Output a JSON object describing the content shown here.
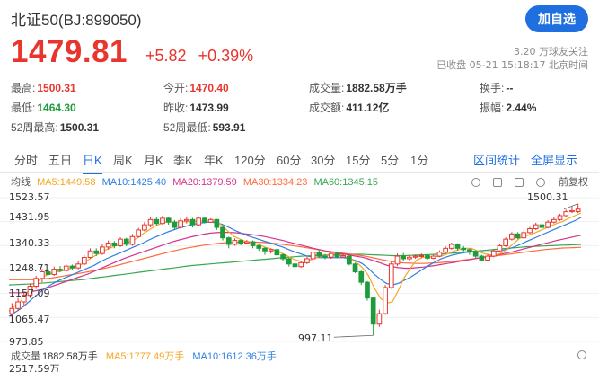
{
  "header": {
    "title": "北证50(BJ:899050)",
    "add_button": "加自选"
  },
  "quote": {
    "price": "1479.81",
    "change": "+5.82",
    "change_pct": "+0.39%",
    "followers": "3.20 万球友关注",
    "status": "已收盘 05-21 15:18:17 北京时间"
  },
  "stats": {
    "high_label": "最高:",
    "high": "1500.31",
    "low_label": "最低:",
    "low": "1464.30",
    "open_label": "今开:",
    "open": "1470.40",
    "prev_label": "昨收:",
    "prev": "1473.99",
    "vol_label": "成交量:",
    "vol": "1882.58万手",
    "amt_label": "成交额:",
    "amt": "411.12亿",
    "turnover_label": "换手:",
    "turnover": "--",
    "amplitude_label": "振幅:",
    "amplitude": "2.44%",
    "w52h_label": "52周最高:",
    "w52h": "1500.31",
    "w52l_label": "52周最低:",
    "w52l": "593.91"
  },
  "tabs": [
    "分时",
    "五日",
    "日K",
    "周K",
    "月K",
    "季K",
    "年K",
    "120分",
    "60分",
    "30分",
    "15分",
    "5分",
    "1分"
  ],
  "tab_right": [
    "区间统计",
    "全屏显示"
  ],
  "ma_legend": {
    "prefix": "均线",
    "ma5": "MA5:1449.58",
    "ma10": "MA10:1425.40",
    "ma20": "MA20:1379.59",
    "ma30": "MA30:1334.23",
    "ma60": "MA60:1345.15"
  },
  "tools": {
    "restore": "前复权"
  },
  "axis": {
    "y1": "1523.57",
    "y2": "1431.95",
    "y3": "1340.33",
    "y4": "1248.71",
    "y5": "1157.09",
    "y6": "1065.47",
    "y7": "973.85",
    "high_mark": "1500.31",
    "low_mark": "997.11"
  },
  "volume": {
    "label": "成交量",
    "value": "1882.58万手",
    "ma5": "MA5:1777.49万手",
    "ma10": "MA10:1612.36万手",
    "max": "2517.59万"
  },
  "colors": {
    "up": "#e8352e",
    "down": "#1e9b3a",
    "ma5": "#f5a623",
    "ma10": "#2f7fe0",
    "ma20": "#d6338a",
    "ma30": "#ff6b3d",
    "ma60": "#3aa655",
    "accent": "#1f6fe0"
  },
  "chart_data": {
    "type": "candlestick",
    "y_range": [
      973.85,
      1523.57
    ],
    "candles": [
      [
        1080,
        1100,
        1050,
        1120
      ],
      [
        1100,
        1125,
        1090,
        1140
      ],
      [
        1125,
        1150,
        1110,
        1160
      ],
      [
        1150,
        1185,
        1140,
        1195
      ],
      [
        1185,
        1215,
        1175,
        1225
      ],
      [
        1215,
        1240,
        1200,
        1250
      ],
      [
        1240,
        1230,
        1220,
        1255
      ],
      [
        1230,
        1250,
        1225,
        1260
      ],
      [
        1250,
        1245,
        1238,
        1262
      ],
      [
        1245,
        1262,
        1240,
        1270
      ],
      [
        1262,
        1255,
        1248,
        1268
      ],
      [
        1255,
        1270,
        1250,
        1280
      ],
      [
        1270,
        1295,
        1265,
        1305
      ],
      [
        1295,
        1320,
        1290,
        1330
      ],
      [
        1320,
        1310,
        1300,
        1330
      ],
      [
        1310,
        1335,
        1305,
        1345
      ],
      [
        1335,
        1350,
        1325,
        1360
      ],
      [
        1350,
        1340,
        1330,
        1358
      ],
      [
        1340,
        1365,
        1335,
        1372
      ],
      [
        1365,
        1345,
        1338,
        1370
      ],
      [
        1345,
        1375,
        1340,
        1385
      ],
      [
        1375,
        1400,
        1370,
        1408
      ],
      [
        1400,
        1420,
        1395,
        1430
      ],
      [
        1420,
        1440,
        1410,
        1450
      ],
      [
        1440,
        1425,
        1415,
        1448
      ],
      [
        1425,
        1445,
        1420,
        1455
      ],
      [
        1445,
        1430,
        1420,
        1450
      ],
      [
        1430,
        1410,
        1400,
        1438
      ],
      [
        1410,
        1435,
        1405,
        1445
      ],
      [
        1435,
        1440,
        1425,
        1452
      ],
      [
        1440,
        1420,
        1410,
        1446
      ],
      [
        1420,
        1445,
        1415,
        1452
      ],
      [
        1445,
        1430,
        1425,
        1450
      ],
      [
        1430,
        1440,
        1428,
        1445
      ],
      [
        1440,
        1410,
        1400,
        1442
      ],
      [
        1410,
        1370,
        1360,
        1415
      ],
      [
        1370,
        1345,
        1330,
        1375
      ],
      [
        1345,
        1360,
        1340,
        1368
      ],
      [
        1360,
        1350,
        1342,
        1365
      ],
      [
        1350,
        1355,
        1345,
        1362
      ],
      [
        1355,
        1340,
        1330,
        1360
      ],
      [
        1340,
        1330,
        1320,
        1345
      ],
      [
        1330,
        1320,
        1305,
        1335
      ],
      [
        1320,
        1325,
        1310,
        1330
      ],
      [
        1325,
        1305,
        1295,
        1330
      ],
      [
        1305,
        1290,
        1280,
        1310
      ],
      [
        1290,
        1270,
        1260,
        1295
      ],
      [
        1270,
        1260,
        1250,
        1275
      ],
      [
        1260,
        1275,
        1255,
        1282
      ],
      [
        1275,
        1290,
        1270,
        1298
      ],
      [
        1290,
        1315,
        1285,
        1320
      ],
      [
        1315,
        1300,
        1295,
        1322
      ],
      [
        1300,
        1296,
        1288,
        1308
      ],
      [
        1296,
        1310,
        1290,
        1316
      ],
      [
        1310,
        1297,
        1292,
        1315
      ],
      [
        1297,
        1302,
        1294,
        1308
      ],
      [
        1300,
        1270,
        1265,
        1302
      ],
      [
        1270,
        1240,
        1235,
        1275
      ],
      [
        1240,
        1200,
        1190,
        1245
      ],
      [
        1200,
        1140,
        1130,
        1205
      ],
      [
        1140,
        1040,
        997.11,
        1145
      ],
      [
        1040,
        1080,
        1030,
        1095
      ],
      [
        1080,
        1180,
        1075,
        1190
      ],
      [
        1180,
        1270,
        1175,
        1280
      ],
      [
        1270,
        1300,
        1262,
        1310
      ],
      [
        1300,
        1290,
        1280,
        1312
      ],
      [
        1290,
        1296,
        1284,
        1305
      ],
      [
        1296,
        1300,
        1290,
        1306
      ],
      [
        1300,
        1302,
        1294,
        1310
      ],
      [
        1302,
        1292,
        1286,
        1306
      ],
      [
        1292,
        1300,
        1288,
        1305
      ],
      [
        1300,
        1315,
        1296,
        1322
      ],
      [
        1315,
        1330,
        1310,
        1338
      ],
      [
        1330,
        1345,
        1325,
        1352
      ],
      [
        1345,
        1330,
        1322,
        1350
      ],
      [
        1330,
        1325,
        1318,
        1338
      ],
      [
        1325,
        1318,
        1305,
        1330
      ],
      [
        1318,
        1300,
        1292,
        1322
      ],
      [
        1300,
        1285,
        1280,
        1305
      ],
      [
        1285,
        1300,
        1280,
        1308
      ],
      [
        1300,
        1320,
        1296,
        1325
      ],
      [
        1320,
        1340,
        1315,
        1348
      ],
      [
        1340,
        1365,
        1335,
        1372
      ],
      [
        1365,
        1385,
        1360,
        1392
      ],
      [
        1385,
        1370,
        1365,
        1392
      ],
      [
        1370,
        1390,
        1366,
        1398
      ],
      [
        1390,
        1405,
        1385,
        1412
      ],
      [
        1405,
        1420,
        1400,
        1428
      ],
      [
        1420,
        1410,
        1405,
        1428
      ],
      [
        1410,
        1430,
        1406,
        1438
      ],
      [
        1430,
        1440,
        1425,
        1448
      ],
      [
        1440,
        1455,
        1435,
        1462
      ],
      [
        1455,
        1470,
        1450,
        1478
      ],
      [
        1470,
        1473.99,
        1465,
        1490
      ],
      [
        1470.4,
        1479.81,
        1464.3,
        1500.31
      ]
    ],
    "ma5": [
      1090,
      1110,
      1130,
      1160,
      1185,
      1210,
      1225,
      1235,
      1240,
      1245,
      1252,
      1260,
      1270,
      1285,
      1300,
      1312,
      1325,
      1335,
      1343,
      1350,
      1355,
      1368,
      1385,
      1400,
      1415,
      1425,
      1432,
      1430,
      1430,
      1432,
      1432,
      1434,
      1434,
      1435,
      1432,
      1418,
      1395,
      1375,
      1365,
      1355,
      1350,
      1345,
      1335,
      1328,
      1320,
      1310,
      1298,
      1286,
      1280,
      1282,
      1290,
      1298,
      1302,
      1304,
      1303,
      1300,
      1292,
      1278,
      1258,
      1228,
      1180,
      1140,
      1120,
      1125,
      1170,
      1220,
      1255,
      1285,
      1295,
      1297,
      1298,
      1300,
      1308,
      1318,
      1325,
      1330,
      1330,
      1320,
      1310,
      1305,
      1305,
      1312,
      1330,
      1350,
      1370,
      1378,
      1385,
      1395,
      1405,
      1415,
      1425,
      1433,
      1445,
      1455,
      1465
    ],
    "ma10": [
      1070,
      1085,
      1100,
      1120,
      1140,
      1160,
      1178,
      1192,
      1205,
      1215,
      1225,
      1235,
      1245,
      1255,
      1265,
      1278,
      1290,
      1300,
      1310,
      1320,
      1330,
      1340,
      1350,
      1362,
      1372,
      1382,
      1392,
      1400,
      1408,
      1414,
      1420,
      1425,
      1428,
      1430,
      1428,
      1422,
      1412,
      1400,
      1390,
      1380,
      1372,
      1365,
      1357,
      1350,
      1342,
      1335,
      1325,
      1316,
      1308,
      1300,
      1296,
      1294,
      1294,
      1294,
      1294,
      1294,
      1290,
      1283,
      1272,
      1255,
      1232,
      1212,
      1196,
      1190,
      1196,
      1208,
      1220,
      1235,
      1250,
      1265,
      1278,
      1290,
      1298,
      1305,
      1310,
      1314,
      1316,
      1316,
      1316,
      1316,
      1318,
      1322,
      1328,
      1335,
      1345,
      1356,
      1366,
      1376,
      1386,
      1396,
      1406,
      1416,
      1426,
      1436,
      1448
    ],
    "ma20": [
      1160,
      1160,
      1160,
      1162,
      1166,
      1170,
      1176,
      1184,
      1192,
      1200,
      1208,
      1216,
      1224,
      1232,
      1242,
      1252,
      1262,
      1272,
      1282,
      1292,
      1300,
      1308,
      1316,
      1324,
      1332,
      1340,
      1348,
      1356,
      1362,
      1368,
      1374,
      1379,
      1384,
      1388,
      1390,
      1391,
      1391,
      1390,
      1388,
      1385,
      1382,
      1379,
      1375,
      1370,
      1365,
      1360,
      1354,
      1348,
      1342,
      1336,
      1330,
      1325,
      1320,
      1316,
      1312,
      1308,
      1304,
      1300,
      1296,
      1290,
      1282,
      1274,
      1266,
      1260,
      1256,
      1254,
      1254,
      1256,
      1258,
      1261,
      1264,
      1268,
      1272,
      1276,
      1280,
      1284,
      1288,
      1292,
      1296,
      1300,
      1304,
      1308,
      1313,
      1318,
      1324,
      1330,
      1336,
      1342,
      1348,
      1354,
      1360,
      1365,
      1370,
      1375,
      1380
    ],
    "ma30": [
      1210,
      1210,
      1210,
      1210,
      1210,
      1212,
      1214,
      1216,
      1220,
      1224,
      1228,
      1232,
      1236,
      1240,
      1245,
      1250,
      1255,
      1260,
      1266,
      1272,
      1278,
      1284,
      1290,
      1296,
      1302,
      1308,
      1314,
      1320,
      1325,
      1330,
      1334,
      1338,
      1342,
      1345,
      1348,
      1350,
      1352,
      1353,
      1354,
      1354,
      1354,
      1353,
      1352,
      1350,
      1348,
      1345,
      1342,
      1339,
      1336,
      1332,
      1328,
      1324,
      1320,
      1317,
      1314,
      1311,
      1308,
      1305,
      1302,
      1298,
      1293,
      1288,
      1283,
      1279,
      1276,
      1274,
      1273,
      1272,
      1272,
      1273,
      1274,
      1276,
      1278,
      1280,
      1283,
      1286,
      1289,
      1292,
      1295,
      1298,
      1301,
      1304,
      1307,
      1310,
      1313,
      1316,
      1319,
      1322,
      1325,
      1327,
      1329,
      1331,
      1332,
      1333,
      1334
    ],
    "ma60": [
      1190,
      1191,
      1192,
      1193,
      1194,
      1196,
      1198,
      1200,
      1202,
      1204,
      1206,
      1208,
      1210,
      1213,
      1216,
      1219,
      1222,
      1225,
      1228,
      1231,
      1234,
      1237,
      1240,
      1243,
      1246,
      1249,
      1252,
      1255,
      1258,
      1261,
      1264,
      1266,
      1268,
      1270,
      1272,
      1274,
      1276,
      1278,
      1280,
      1282,
      1284,
      1286,
      1288,
      1290,
      1292,
      1294,
      1296,
      1298,
      1300,
      1301,
      1302,
      1303,
      1304,
      1305,
      1306,
      1307,
      1307,
      1307,
      1307,
      1306,
      1305,
      1304,
      1303,
      1302,
      1302,
      1302,
      1303,
      1304,
      1305,
      1306,
      1307,
      1308,
      1310,
      1312,
      1314,
      1316,
      1318,
      1320,
      1322,
      1324,
      1326,
      1328,
      1330,
      1332,
      1334,
      1336,
      1337,
      1338,
      1339,
      1340,
      1341,
      1342,
      1343,
      1344,
      1345
    ]
  }
}
